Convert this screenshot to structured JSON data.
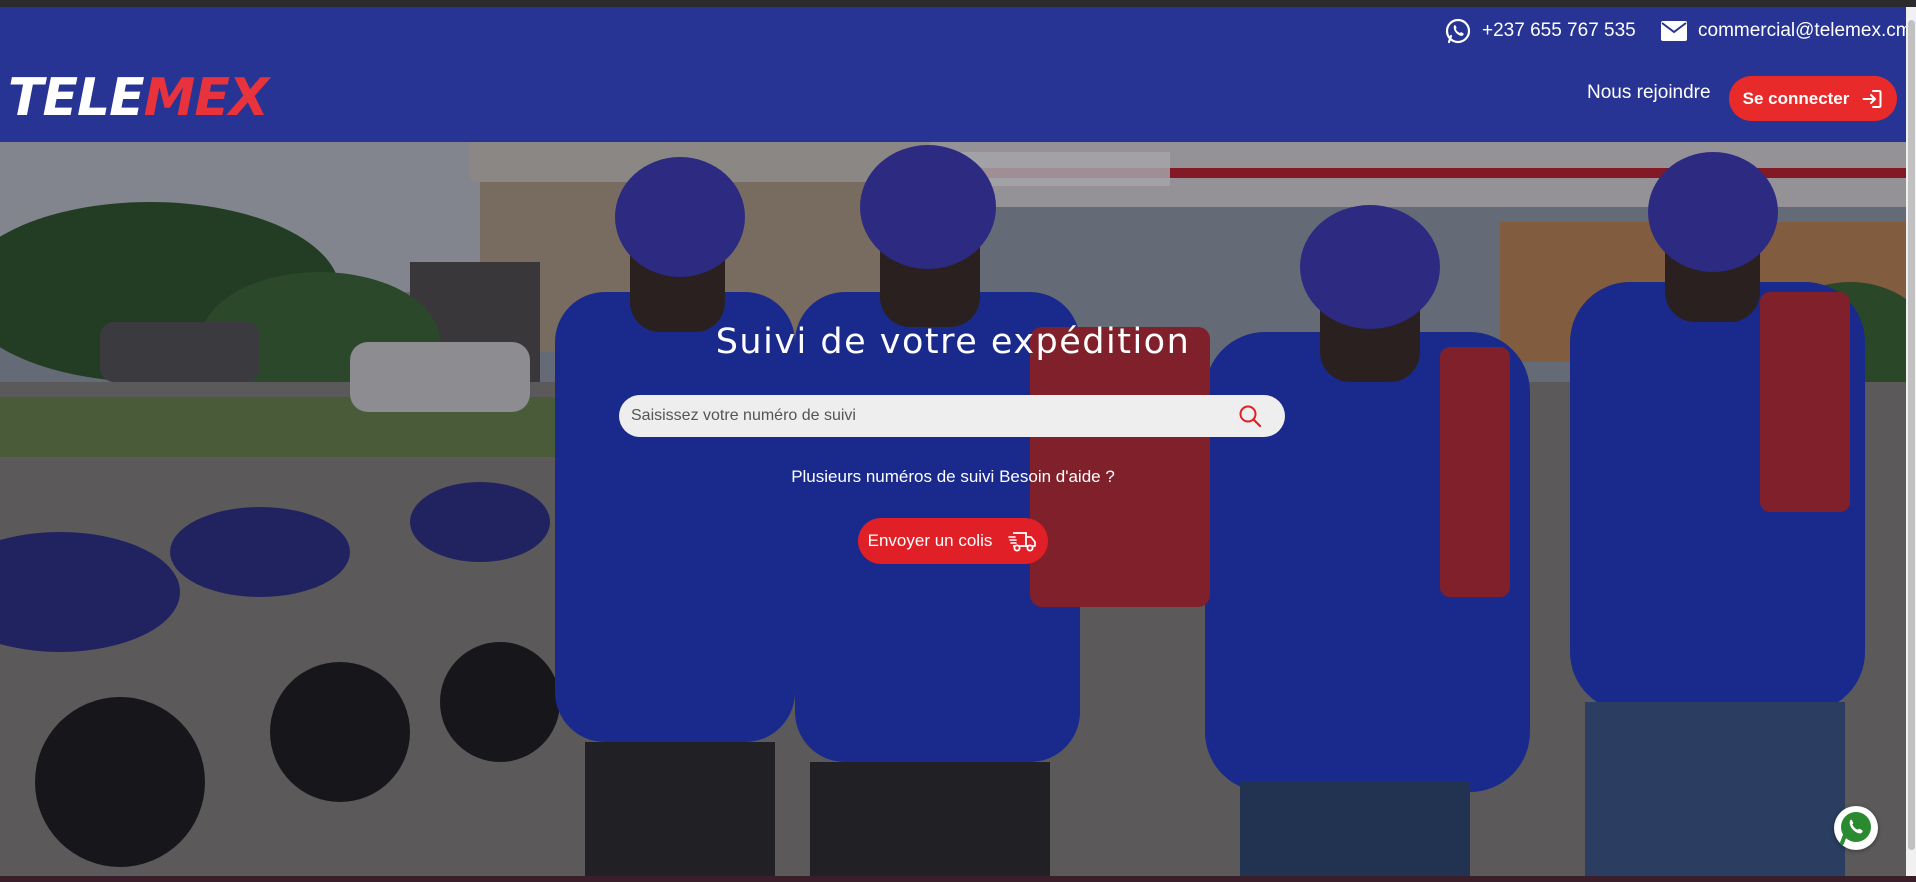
{
  "contact": {
    "phone": "+237 655 767 535",
    "email": "commercial@telemex.cm",
    "phone_icon": "whatsapp-icon",
    "email_icon": "envelope-icon"
  },
  "brand": {
    "logo_part1": "TELE",
    "logo_part2": "MEX",
    "bar_color": "#283493",
    "accent_color": "#e82a2a"
  },
  "nav": {
    "join_label": "Nous rejoindre",
    "login_label": "Se connecter",
    "login_icon": "sign-in-icon"
  },
  "hero": {
    "title": "Suivi de votre expédition",
    "search_placeholder": "Saisissez votre numéro de suivi",
    "search_icon": "search-icon",
    "multi_tracking_link": "Plusieurs numéros de suivi",
    "help_link": "Besoin d'aide ?",
    "send_button_label": "Envoyer un colis",
    "send_button_icon": "delivery-truck-icon",
    "background_image": "delivery riders in blue uniforms and helmets in front of a TotalEnergies station with motorbikes"
  },
  "floating": {
    "whatsapp_icon": "whatsapp-icon"
  }
}
